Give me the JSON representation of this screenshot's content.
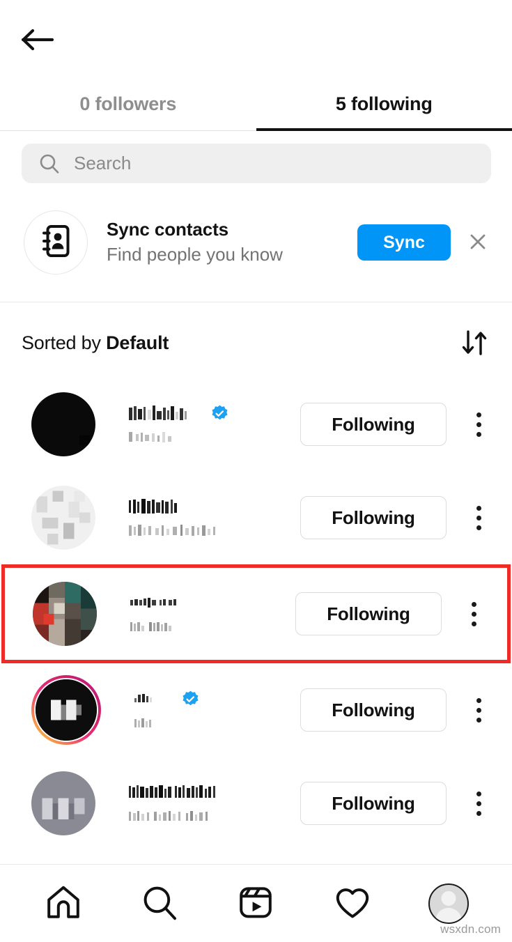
{
  "header": {
    "back_icon": "arrow-left-icon"
  },
  "tabs": [
    {
      "label": "0 followers",
      "active": false
    },
    {
      "label": "5 following",
      "active": true
    }
  ],
  "search": {
    "placeholder": "Search",
    "value": "",
    "icon": "search-icon"
  },
  "sync_contacts": {
    "icon": "contact-book-icon",
    "title": "Sync contacts",
    "subtitle": "Find people you know",
    "button_label": "Sync",
    "button_color": "#0095f6",
    "close_icon": "close-icon"
  },
  "sort": {
    "prefix": "Sorted by ",
    "value": "Default",
    "icon": "sort-arrows-icon"
  },
  "list": {
    "action_label": "Following",
    "menu_icon": "kebab-menu-icon",
    "highlight_color": "#ee2b24",
    "rows": [
      {
        "username_redacted": true,
        "fullname_redacted": true,
        "verified": true,
        "has_story_ring": false,
        "avatar_tone": "#0a0a0a",
        "action": "Following",
        "highlighted": false
      },
      {
        "username_redacted": true,
        "fullname_redacted": true,
        "verified": false,
        "has_story_ring": false,
        "avatar_tone": "#e8e8e8",
        "action": "Following",
        "highlighted": false
      },
      {
        "username_redacted": true,
        "fullname_redacted": true,
        "verified": false,
        "has_story_ring": false,
        "avatar_tone": "#7a5f58",
        "action": "Following",
        "highlighted": true
      },
      {
        "username_redacted": true,
        "fullname_redacted": true,
        "verified": true,
        "has_story_ring": true,
        "avatar_tone": "#0d0d0d",
        "action": "Following",
        "highlighted": false
      },
      {
        "username_redacted": true,
        "fullname_redacted": true,
        "verified": false,
        "has_story_ring": false,
        "avatar_tone": "#8a8a94",
        "action": "Following",
        "highlighted": false
      }
    ]
  },
  "bottom_nav": [
    {
      "icon": "home-icon",
      "active": false
    },
    {
      "icon": "search-icon",
      "active": false
    },
    {
      "icon": "reels-icon",
      "active": false
    },
    {
      "icon": "heart-icon",
      "active": false
    },
    {
      "icon": "profile-avatar-icon",
      "active": true
    }
  ],
  "watermark": "wsxdn.com"
}
